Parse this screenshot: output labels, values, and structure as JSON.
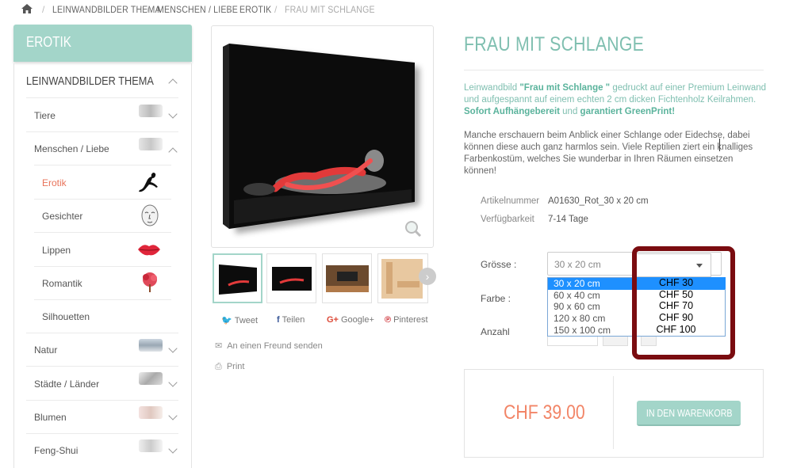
{
  "breadcrumb": {
    "items": [
      "LEINWANDBILDER THEMA",
      "MENSCHEN / LIEBE",
      "EROTIK"
    ],
    "current": "FRAU MIT SCHLANGE"
  },
  "sidebar": {
    "header": "EROTIK",
    "category_title": "LEINWANDBILDER THEMA",
    "items": [
      {
        "label": "Tiere"
      },
      {
        "label": "Menschen / Liebe"
      },
      {
        "label": "Erotik"
      },
      {
        "label": "Gesichter"
      },
      {
        "label": "Lippen"
      },
      {
        "label": "Romantik"
      },
      {
        "label": "Silhouetten"
      },
      {
        "label": "Natur"
      },
      {
        "label": "Städte / Länder"
      },
      {
        "label": "Blumen"
      },
      {
        "label": "Feng-Shui"
      }
    ]
  },
  "share": {
    "tweet": "Tweet",
    "teilen": "Teilen",
    "google": "Google+",
    "pinterest": "Pinterest",
    "send_friend": "An einen Freund senden",
    "print": "Print"
  },
  "product": {
    "title": "FRAU MIT SCHLANGE",
    "desc1_a": "Leinwandbild ",
    "desc1_b": "\"Frau mit Schlange \"",
    "desc1_c": " gedruckt auf einer Premium Leinwand und aufgespannt auf einem echten 2 cm dicken Fichtenholz Keilrahmen. ",
    "desc1_d": "Sofort Aufhängebereit",
    "desc1_e": " und ",
    "desc1_f": "garantiert GreenPrint!",
    "desc2": "Manche erschauern beim Anblick einer Schlange oder Eidechse, dabei können diese auch ganz harmlos sein. Viele Reptilien ziert ein knalliges Farbenkostüm, welches Sie wunderbar in Ihren Räumen einsetzen können!",
    "article_label": "Artikelnummer",
    "article_value": "A01630_Rot_30 x 20 cm",
    "availability_label": "Verfügbarkeit",
    "availability_value": "7-14 Tage"
  },
  "options": {
    "size_label": "Grösse :",
    "color_label": "Farbe :",
    "qty_label": "Anzahl",
    "size_selected": "30 x 20 cm",
    "size_options": [
      "30 x 20 cm",
      "60 x 40 cm",
      "90 x 60 cm",
      "120 x 80 cm",
      "150 x 100 cm"
    ],
    "price_options": [
      "CHF 30",
      "CHF 50",
      "CHF 70",
      "CHF 90",
      "CHF 100"
    ]
  },
  "cart": {
    "price": "CHF 39.00",
    "button": "IN DEN WARENKORB"
  },
  "colors": {
    "accent": "#a3d5c9",
    "price": "#f28567",
    "highlight": "#1e90ff",
    "frame": "#7a0c10"
  }
}
